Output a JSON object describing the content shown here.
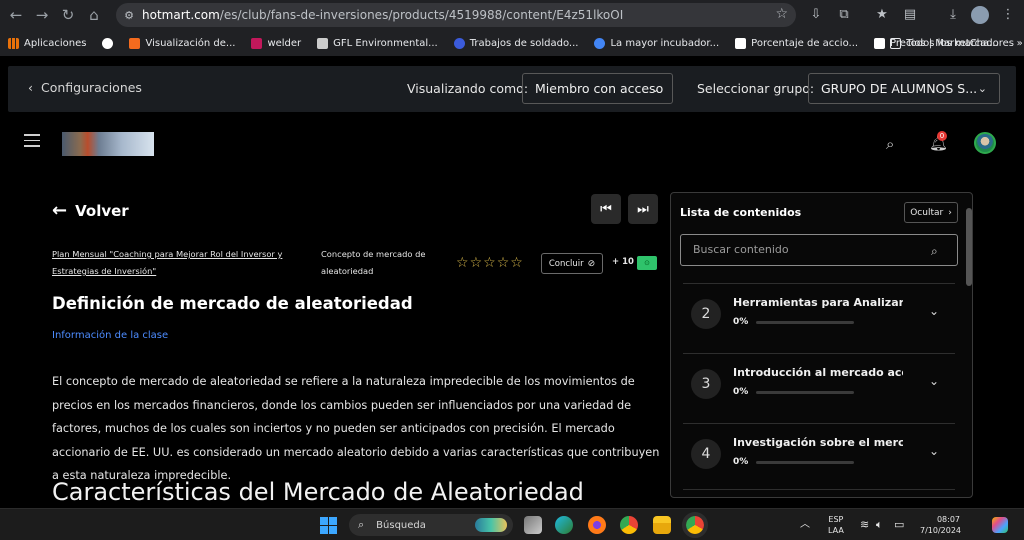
{
  "browser": {
    "url_host": "hotmart.com",
    "url_path": "/es/club/fans-de-inversiones/products/4519988/content/E4z51lkoOI",
    "bookmarks": [
      {
        "label": "Aplicaciones",
        "color": "#e8710a"
      },
      {
        "label": "",
        "color": "#ffffff"
      },
      {
        "label": "Visualización de...",
        "color": "#f46b1e"
      },
      {
        "label": "welder",
        "color": "#c2185b"
      },
      {
        "label": "GFL Environmental...",
        "color": "#cccccc"
      },
      {
        "label": "Trabajos de soldado...",
        "color": "#3b5bdb"
      },
      {
        "label": "La mayor incubador...",
        "color": "#4285f4"
      },
      {
        "label": "Porcentaje de accio...",
        "color": "#ffffff"
      },
      {
        "label": "Precios | MarketCha...",
        "color": "#ffffff"
      }
    ],
    "more_label": "»",
    "all_bookmarks_label": "Todos los marcadores"
  },
  "admin_bar": {
    "back_label": "Configuraciones",
    "viewing_as_label": "Visualizando como:",
    "viewing_as_value": "Miembro con acceso",
    "group_label": "Seleccionar grupo:",
    "group_value": "GRUPO DE ALUMNOS S..."
  },
  "header": {
    "notification_count": "0"
  },
  "lesson": {
    "back_label": "Volver",
    "breadcrumb_course": "Plan Mensual \"Coaching para Mejorar Rol del Inversor y Estrategias de Inversión\"",
    "breadcrumb_lesson": "Concepto de mercado de aleatoriedad",
    "rating": 0,
    "rating_max": 5,
    "complete_label": "Concluir",
    "points_label": "+ 10",
    "title": "Definición de mercado de aleatoriedad",
    "info_link": "Información de la clase",
    "body": "El concepto de mercado de aleatoriedad se refiere a la naturaleza impredecible de los movimientos de precios en los mercados financieros, donde los cambios pueden ser influenciados por una variedad de factores, muchos de los cuales son inciertos y no pueden ser anticipados con precisión. El mercado accionario de EE. UU. es considerado un mercado aleatorio debido a varias características que contribuyen a esta naturaleza impredecible.",
    "section_heading": "Características del Mercado de Aleatoriedad"
  },
  "contents_panel": {
    "title": "Lista de contenidos",
    "hide_label": "Ocultar",
    "search_placeholder": "Buscar contenido",
    "modules": [
      {
        "number": "2",
        "name": "Herramientas para Analizar...",
        "progress_label": "0%",
        "progress": 0
      },
      {
        "number": "3",
        "name": "Introducción al mercado accionario...",
        "progress_label": "0%",
        "progress": 0
      },
      {
        "number": "4",
        "name": "Investigación sobre el mercado...",
        "progress_label": "0%",
        "progress": 0
      }
    ]
  },
  "taskbar": {
    "search_label": "Búsqueda",
    "lang_top": "ESP",
    "lang_bottom": "LAA",
    "time": "08:07",
    "date": "7/10/2024"
  }
}
